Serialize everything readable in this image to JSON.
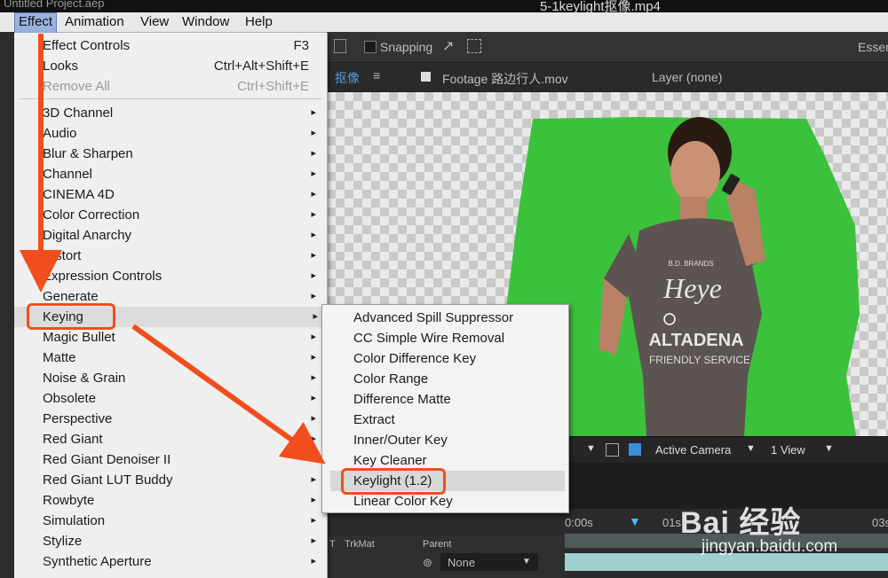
{
  "title_bar": {
    "project": "Untitled Project.aep",
    "file": "5-1keylight抠像.mp4"
  },
  "menubar": {
    "items": [
      "Effect",
      "Animation",
      "View",
      "Window",
      "Help"
    ]
  },
  "toolbar": {
    "snapping_label": "Snapping",
    "workspace_label": "Essen"
  },
  "tabs": {
    "comp_tab": "抠像",
    "footage_tab": "Footage 路边行人.mov",
    "layer_tab": "Layer (none)"
  },
  "viewer": {
    "shirt_line1": "B.D. BRANDS",
    "shirt_line2": "Heye",
    "shirt_line3": "ALTADENA",
    "shirt_line4": "FRIENDLY SERVICE",
    "bottom_camera": "Active Camera",
    "bottom_views": "1 View"
  },
  "timeline": {
    "time_0": "0:00s",
    "time_1": "01s",
    "time_3": "03s",
    "trkmat_header": "TrkMat",
    "parent_header": "Parent",
    "parent_value": "None",
    "t_header": "T"
  },
  "effect_menu": {
    "items": [
      {
        "label": "Effect Controls",
        "shortcut": "F3",
        "submenu": false,
        "disabled": false
      },
      {
        "label": "Looks",
        "shortcut": "Ctrl+Alt+Shift+E",
        "submenu": false,
        "disabled": false
      },
      {
        "label": "Remove All",
        "shortcut": "Ctrl+Shift+E",
        "submenu": false,
        "disabled": true
      },
      {
        "label": "3D Channel",
        "shortcut": "",
        "submenu": true,
        "disabled": false
      },
      {
        "label": "Audio",
        "shortcut": "",
        "submenu": true,
        "disabled": false
      },
      {
        "label": "Blur & Sharpen",
        "shortcut": "",
        "submenu": true,
        "disabled": false
      },
      {
        "label": "Channel",
        "shortcut": "",
        "submenu": true,
        "disabled": false
      },
      {
        "label": "CINEMA 4D",
        "shortcut": "",
        "submenu": true,
        "disabled": false
      },
      {
        "label": "Color Correction",
        "shortcut": "",
        "submenu": true,
        "disabled": false
      },
      {
        "label": "Digital Anarchy",
        "shortcut": "",
        "submenu": true,
        "disabled": false
      },
      {
        "label": "Distort",
        "shortcut": "",
        "submenu": true,
        "disabled": false
      },
      {
        "label": "Expression Controls",
        "shortcut": "",
        "submenu": true,
        "disabled": false
      },
      {
        "label": "Generate",
        "shortcut": "",
        "submenu": true,
        "disabled": false
      },
      {
        "label": "Keying",
        "shortcut": "",
        "submenu": true,
        "disabled": false
      },
      {
        "label": "Magic Bullet",
        "shortcut": "",
        "submenu": true,
        "disabled": false
      },
      {
        "label": "Matte",
        "shortcut": "",
        "submenu": true,
        "disabled": false
      },
      {
        "label": "Noise & Grain",
        "shortcut": "",
        "submenu": true,
        "disabled": false
      },
      {
        "label": "Obsolete",
        "shortcut": "",
        "submenu": true,
        "disabled": false
      },
      {
        "label": "Perspective",
        "shortcut": "",
        "submenu": true,
        "disabled": false
      },
      {
        "label": "Red Giant",
        "shortcut": "",
        "submenu": true,
        "disabled": false
      },
      {
        "label": "Red Giant Denoiser II",
        "shortcut": "",
        "submenu": true,
        "disabled": false
      },
      {
        "label": "Red Giant LUT Buddy",
        "shortcut": "",
        "submenu": true,
        "disabled": false
      },
      {
        "label": "Rowbyte",
        "shortcut": "",
        "submenu": true,
        "disabled": false
      },
      {
        "label": "Simulation",
        "shortcut": "",
        "submenu": true,
        "disabled": false
      },
      {
        "label": "Stylize",
        "shortcut": "",
        "submenu": true,
        "disabled": false
      },
      {
        "label": "Synthetic Aperture",
        "shortcut": "",
        "submenu": true,
        "disabled": false
      }
    ]
  },
  "keying_submenu": {
    "items": [
      "Advanced Spill Suppressor",
      "CC Simple Wire Removal",
      "Color Difference Key",
      "Color Range",
      "Difference Matte",
      "Extract",
      "Inner/Outer Key",
      "Key Cleaner",
      "Keylight (1.2)",
      "Linear Color Key"
    ],
    "selected": "Keylight (1.2)"
  },
  "watermark": {
    "logo": "Bai 经验",
    "url": "jingyan.baidu.com"
  },
  "colors": {
    "highlight": "#f04e1d",
    "menu_bg": "#efefef",
    "green_screen": "#3cc13c",
    "menu_selected": "#9ab2e0"
  }
}
